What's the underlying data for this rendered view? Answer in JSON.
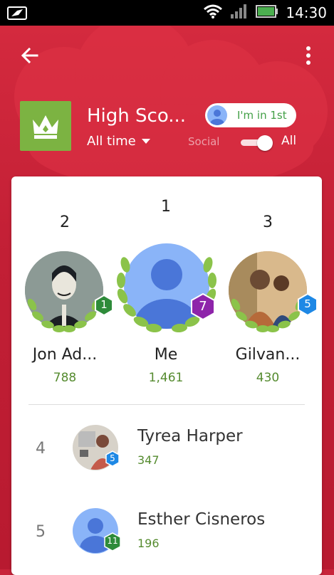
{
  "status_bar": {
    "time": "14:30"
  },
  "header": {
    "title": "High Sco...",
    "time_filter": "All time",
    "chip_label": "I'm in 1st",
    "social_label": "Social",
    "all_label": "All"
  },
  "podium": [
    {
      "rank": "2",
      "name": "Jon Ad...",
      "score": "788",
      "level": "1",
      "level_color": "#2e8b3a"
    },
    {
      "rank": "1",
      "name": "Me",
      "score": "1,461",
      "level": "7",
      "level_color": "#8e24aa"
    },
    {
      "rank": "3",
      "name": "Gilvan...",
      "score": "430",
      "level": "5",
      "level_color": "#1e88e5"
    }
  ],
  "list": [
    {
      "rank": "4",
      "name": "Tyrea Harper",
      "score": "347",
      "level": "5",
      "level_color": "#1e88e5"
    },
    {
      "rank": "5",
      "name": "Esther Cisneros",
      "score": "196",
      "level": "11",
      "level_color": "#2e8b3a"
    }
  ],
  "colors": {
    "primary": "#c8243a",
    "accent_green": "#7cb342",
    "score_green": "#558b2f",
    "me_avatar": "#8ab4f8"
  },
  "icons": [
    "back-arrow-icon",
    "more-vert-icon",
    "crown-icon",
    "wifi-icon",
    "signal-icon",
    "battery-icon",
    "laurel-icon"
  ]
}
